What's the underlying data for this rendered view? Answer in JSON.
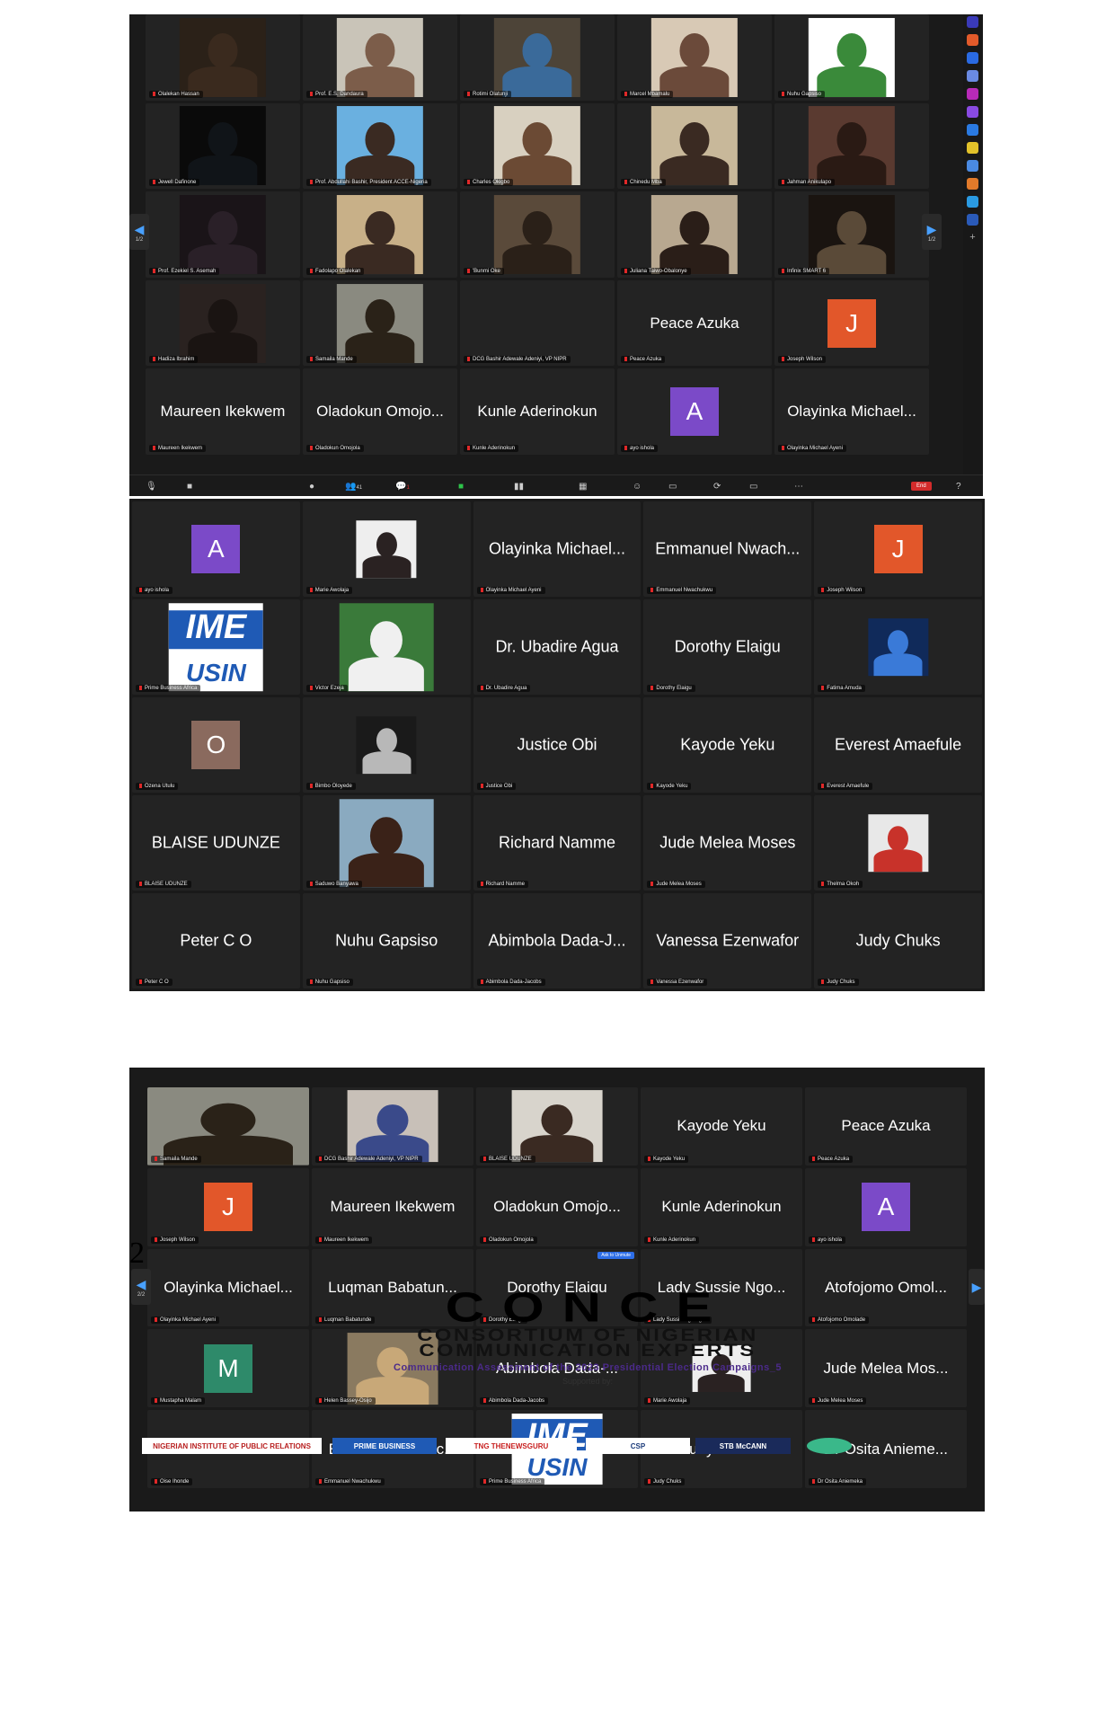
{
  "screenshot1": {
    "pager": "1/2",
    "participants": "41",
    "chat_badge": "1",
    "end_label": "End",
    "tiles": [
      {
        "label": "Olalekan Hassan",
        "type": "photo",
        "c1": "#2b2118",
        "c2": "#3a2a1e"
      },
      {
        "label": "Prof. E.S. Dandaura",
        "type": "photo",
        "c1": "#c9c4b8",
        "c2": "#7c5d4a"
      },
      {
        "label": "Rotimi Olatunji",
        "type": "photo",
        "c1": "#4d4438",
        "c2": "#3a6a9a"
      },
      {
        "label": "Marcel Mbamalu",
        "type": "photo",
        "c1": "#d8c9b5",
        "c2": "#6b4a3a"
      },
      {
        "label": "Nuhu Gapsiso",
        "type": "photo",
        "c1": "#ffffff",
        "c2": "#3a8a3a"
      },
      {
        "label": "Jewell Dafinone",
        "type": "photo",
        "c1": "#0a0a0a",
        "c2": "#101418"
      },
      {
        "label": "Prof. Abdullahi Bashir, President ACCE-Nigeria",
        "type": "photo",
        "c1": "#6ab0e0",
        "c2": "#3a2a22"
      },
      {
        "label": "Charles Okigbo",
        "type": "photo",
        "c1": "#d8d0c0",
        "c2": "#6b4a34"
      },
      {
        "label": "Chinedu Mba",
        "type": "photo",
        "c1": "#c8b89a",
        "c2": "#3a2a22"
      },
      {
        "label": "Jahman Anikulapo",
        "type": "photo",
        "c1": "#5a3a30",
        "c2": "#2a1a14"
      },
      {
        "label": "Prof. Ezekiel S. Asemah",
        "type": "photo",
        "c1": "#1a1418",
        "c2": "#2a2028"
      },
      {
        "label": "Fadolapo Olalekan",
        "type": "photo",
        "c1": "#c8b088",
        "c2": "#3a2a22"
      },
      {
        "label": "'Bunmi Oke",
        "type": "photo",
        "c1": "#5a4a3a",
        "c2": "#2a2018"
      },
      {
        "label": "Juliana Taiwo-Obalonye",
        "type": "photo",
        "c1": "#b8a890",
        "c2": "#2a1e18"
      },
      {
        "label": "Infinix SMART 6",
        "type": "photo",
        "c1": "#1a1410",
        "c2": "#5a4a38"
      },
      {
        "label": "Hadiza Ibrahim",
        "type": "photo",
        "c1": "#2a2220",
        "c2": "#1a1412"
      },
      {
        "label": "Samaila Mande",
        "type": "photo",
        "c1": "#8a8a80",
        "c2": "#2a2218"
      },
      {
        "label": "DCG Bashir Adewale Adeniyi, VP NIPR",
        "type": "blank"
      },
      {
        "label": "Peace Azuka",
        "type": "name",
        "name": "Peace Azuka"
      },
      {
        "label": "Joseph Wilson",
        "type": "avatar",
        "letter": "J",
        "color": "#e2572a"
      },
      {
        "label": "Maureen Ikekwem",
        "type": "name",
        "name": "Maureen Ikekwem"
      },
      {
        "label": "Oladokun Omojola",
        "type": "name",
        "name": "Oladokun Omojo..."
      },
      {
        "label": "Kunle Aderinokun",
        "type": "name",
        "name": "Kunle Aderinokun"
      },
      {
        "label": "ayo ishola",
        "type": "avatar",
        "letter": "A",
        "color": "#7b4ac8"
      },
      {
        "label": "Olayinka Michael Ayeni",
        "type": "name",
        "name": "Olayinka Michael..."
      }
    ]
  },
  "screenshot2": {
    "tiles": [
      {
        "label": "ayo ishola",
        "type": "avatar",
        "letter": "A",
        "color": "#7b4ac8"
      },
      {
        "label": "Marie Awolaja",
        "type": "photo-sq",
        "c1": "#eeeeee",
        "c2": "#2a2222"
      },
      {
        "label": "Olayinka Michael Ayeni",
        "type": "name",
        "name": "Olayinka Michael..."
      },
      {
        "label": "Emmanuel Nwachukwu",
        "type": "name",
        "name": "Emmanuel Nwach..."
      },
      {
        "label": "Joseph Wilson",
        "type": "avatar",
        "letter": "J",
        "color": "#e2572a"
      },
      {
        "label": "Prime Business Africa",
        "type": "ime",
        "t": "IME",
        "b": "USIN"
      },
      {
        "label": "Victor Ezeja",
        "type": "photo",
        "c1": "#3a7a3a",
        "c2": "#f0f0f0"
      },
      {
        "label": "Dr. Ubadire Agua",
        "type": "name",
        "name": "Dr. Ubadire Agua"
      },
      {
        "label": "Dorothy Elaigu",
        "type": "name",
        "name": "Dorothy Elaigu"
      },
      {
        "label": "Fatima Amuda",
        "type": "photo-sq",
        "c1": "#102a5a",
        "c2": "#3a7ad8"
      },
      {
        "label": "Ozena Utulu",
        "type": "avatar",
        "letter": "O",
        "color": "#8a6a5e"
      },
      {
        "label": "Bimbo Oloyede",
        "type": "photo-sq",
        "c1": "#1a1a1a",
        "c2": "#b8b8b8"
      },
      {
        "label": "Justice Obi",
        "type": "name",
        "name": "Justice Obi"
      },
      {
        "label": "Kayode Yeku",
        "type": "name",
        "name": "Kayode Yeku"
      },
      {
        "label": "Everest Amaefule",
        "type": "name",
        "name": "Everest Amaefule"
      },
      {
        "label": "BLAISE UDUNZE",
        "type": "name",
        "name": "BLAISE UDUNZE"
      },
      {
        "label": "Saduwo Banyawa",
        "type": "photo",
        "c1": "#8aaac0",
        "c2": "#3a2218"
      },
      {
        "label": "Richard Namme",
        "type": "name",
        "name": "Richard Namme"
      },
      {
        "label": "Jude Melea Moses",
        "type": "name",
        "name": "Jude Melea Moses"
      },
      {
        "label": "Thelma Okoh",
        "type": "photo-sq",
        "c1": "#e8e8e8",
        "c2": "#c8322a"
      },
      {
        "label": "Peter C O",
        "type": "name",
        "name": "Peter C O"
      },
      {
        "label": "Nuhu Gapsiso",
        "type": "name",
        "name": "Nuhu Gapsiso"
      },
      {
        "label": "Abimbola Dada-Jacobs",
        "type": "name",
        "name": "Abimbola Dada-J..."
      },
      {
        "label": "Vanessa Ezenwafor",
        "type": "name",
        "name": "Vanessa Ezenwafor"
      },
      {
        "label": "Judy Chuks",
        "type": "name",
        "name": "Judy Chuks"
      }
    ]
  },
  "screenshot3": {
    "pager": "2/2",
    "unmute_label": "Ask to Unmute",
    "tiles": [
      {
        "label": "Samaila Mande",
        "type": "photo-full",
        "c1": "#8a8a80",
        "c2": "#2a2218"
      },
      {
        "label": "DCG Bashir Adewale Adeniyi, VP NIPR",
        "type": "photo",
        "c1": "#c8c0b8",
        "c2": "#3a4a8a"
      },
      {
        "label": "BLAISE UDUNZE",
        "type": "photo",
        "c1": "#d8d4cc",
        "c2": "#3a2a22"
      },
      {
        "label": "Kayode Yeku",
        "type": "name",
        "name": "Kayode Yeku"
      },
      {
        "label": "Peace Azuka",
        "type": "name",
        "name": "Peace Azuka"
      },
      {
        "label": "Joseph Wilson",
        "type": "avatar",
        "letter": "J",
        "color": "#e2572a"
      },
      {
        "label": "Maureen Ikekwem",
        "type": "name",
        "name": "Maureen Ikekwem"
      },
      {
        "label": "Oladokun Omojola",
        "type": "name",
        "name": "Oladokun Omojo..."
      },
      {
        "label": "Kunle Aderinokun",
        "type": "name",
        "name": "Kunle Aderinokun"
      },
      {
        "label": "ayo ishola",
        "type": "avatar",
        "letter": "A",
        "color": "#7b4ac8"
      },
      {
        "label": "Olayinka Michael Ayeni",
        "type": "name",
        "name": "Olayinka Michael..."
      },
      {
        "label": "Luqman Babatunde",
        "type": "name",
        "name": "Luqman Babatun..."
      },
      {
        "label": "Dorothy Elaigu",
        "type": "name",
        "name": "Dorothy Elaigu",
        "unmute": true
      },
      {
        "label": "Lady Sussie Ngo Agbo",
        "type": "name",
        "name": "Lady Sussie Ngo..."
      },
      {
        "label": "Atofojomo Omolade",
        "type": "name",
        "name": "Atofojomo Omol..."
      },
      {
        "label": "Mustapha Malam",
        "type": "avatar",
        "letter": "M",
        "color": "#2e8a6a"
      },
      {
        "label": "Helen Bassey-Osijo",
        "type": "photo",
        "c1": "#8a7a60",
        "c2": "#c8a878"
      },
      {
        "label": "Abimbola Dada-Jacobs",
        "type": "name",
        "name": "Abimbola Dada-..."
      },
      {
        "label": "Marie Awolaja",
        "type": "photo-sq",
        "c1": "#eeeeee",
        "c2": "#2a2222"
      },
      {
        "label": "Jude Melea Moses",
        "type": "name",
        "name": "Jude Melea Mos..."
      },
      {
        "label": "Oise Ihonde",
        "type": "name",
        "name": "Oise Ihonde"
      },
      {
        "label": "Emmanuel Nwachukwu",
        "type": "name",
        "name": "Emmanuel Nwac..."
      },
      {
        "label": "Prime Business Africa",
        "type": "ime",
        "t": "IME",
        "b": "USIN"
      },
      {
        "label": "Judy Chuks",
        "type": "name",
        "name": "Judy Chuks"
      },
      {
        "label": "Dr Osita Aniemeka",
        "type": "name",
        "name": "Dr Osita Anieme..."
      }
    ]
  },
  "page_number": "2",
  "logo": {
    "wordmark": "CONCE",
    "line1": "CONSORTIUM OF NIGERIAN",
    "line2": "COMMUNICATION EXPERTS",
    "tagline": "Communication Assessment of the 2023 Presidential Election Campaigns_5",
    "supported": "Supported by:"
  },
  "sponsors": [
    {
      "text": "NIGERIAN INSTITUTE OF PUBLIC RELATIONS",
      "color": "#b82020",
      "bg": "#ffffff"
    },
    {
      "text": "PRIME BUSINESS",
      "color": "#ffffff",
      "bg": "#1f5ab5"
    },
    {
      "text": "TNG THENEWSGURU",
      "color": "#c82020",
      "bg": "#ffffff"
    },
    {
      "text": "CSP",
      "color": "#1a3a7a",
      "bg": "#ffffff"
    },
    {
      "text": "STB McCANN",
      "color": "#ffffff",
      "bg": "#1a2a5a"
    }
  ]
}
